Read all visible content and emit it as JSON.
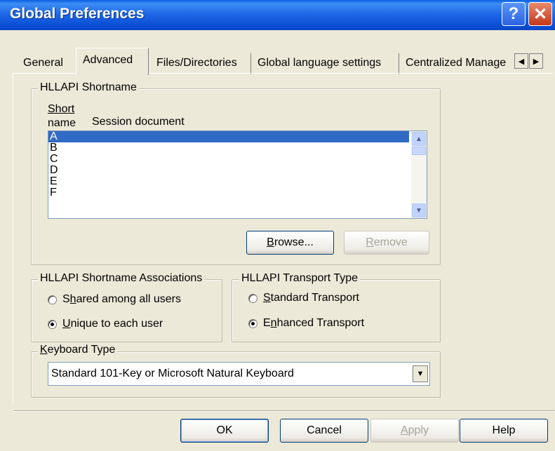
{
  "window": {
    "title": "Global Preferences",
    "help_glyph": "?",
    "close_glyph": "✕"
  },
  "tabs": [
    {
      "label": "General"
    },
    {
      "label": "Advanced"
    },
    {
      "label": "Files/Directories"
    },
    {
      "label": "Global language settings"
    },
    {
      "label": "Centralized Manage"
    }
  ],
  "tab_scroll": {
    "left": "◀",
    "right": "▶"
  },
  "shortname_group": {
    "legend": "HLLAPI Shortname",
    "col_short_line1": "Short",
    "col_short_line2": "name",
    "col_session": "Session document",
    "items": [
      "A",
      "B",
      "C",
      "D",
      "E",
      "F"
    ],
    "selected": "A",
    "scroll_up": "▲",
    "scroll_down": "▼",
    "browse_pre": "",
    "browse_key": "B",
    "browse_post": "rowse...",
    "remove_pre": "",
    "remove_key": "R",
    "remove_post": "emove"
  },
  "associations_group": {
    "legend": "HLLAPI Shortname Associations",
    "opt1_pre": "S",
    "opt1_key": "h",
    "opt1_post": "ared among all users",
    "opt1_checked": false,
    "opt2_pre": "",
    "opt2_key": "U",
    "opt2_post": "nique to each user",
    "opt2_checked": true
  },
  "transport_group": {
    "legend": "HLLAPI Transport Type",
    "opt1_pre": "",
    "opt1_key": "S",
    "opt1_post": "tandard Transport",
    "opt1_checked": false,
    "opt2_pre": "E",
    "opt2_key": "n",
    "opt2_post": "hanced Transport",
    "opt2_checked": true
  },
  "keyboard_group": {
    "legend_key": "K",
    "legend_post": "eyboard Type",
    "value": "Standard 101-Key or Microsoft Natural Keyboard",
    "arrow": "▼"
  },
  "footer": {
    "ok": "OK",
    "cancel": "Cancel",
    "apply_key": "A",
    "apply_post": "pply",
    "help": "Help"
  }
}
